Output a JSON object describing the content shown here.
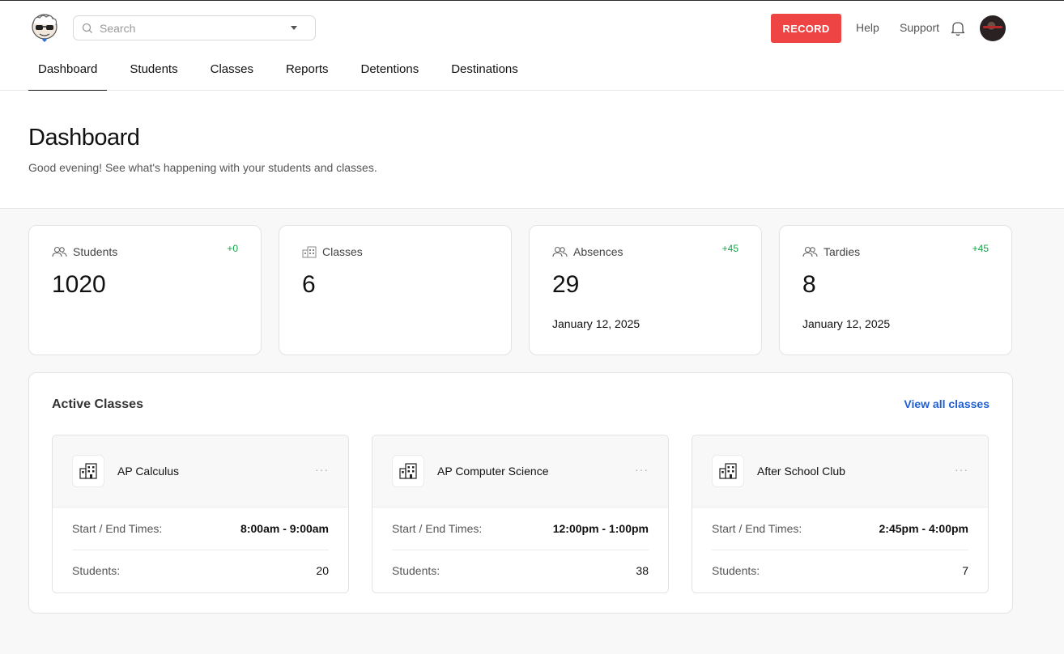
{
  "search": {
    "placeholder": "Search"
  },
  "header": {
    "record_label": "RECORD",
    "help_label": "Help",
    "support_label": "Support"
  },
  "nav": {
    "items": [
      {
        "label": "Dashboard",
        "active": true
      },
      {
        "label": "Students"
      },
      {
        "label": "Classes"
      },
      {
        "label": "Reports"
      },
      {
        "label": "Detentions"
      },
      {
        "label": "Destinations"
      }
    ]
  },
  "page": {
    "title": "Dashboard",
    "subtitle": "Good evening! See what's happening with your students and classes."
  },
  "stats": [
    {
      "label": "Students",
      "value": "1020",
      "delta": "+0",
      "date": "",
      "icon": "users-icon"
    },
    {
      "label": "Classes",
      "value": "6",
      "delta": "",
      "date": "",
      "icon": "building-icon"
    },
    {
      "label": "Absences",
      "value": "29",
      "delta": "+45",
      "date": "January 12, 2025",
      "icon": "users-icon"
    },
    {
      "label": "Tardies",
      "value": "8",
      "delta": "+45",
      "date": "January 12, 2025",
      "icon": "users-icon"
    }
  ],
  "active_classes": {
    "title": "Active Classes",
    "view_all_label": "View all classes",
    "times_label": "Start / End Times:",
    "students_label": "Students:",
    "menu_glyph": "···",
    "classes": [
      {
        "name": "AP Calculus",
        "times": "8:00am - 9:00am",
        "students": "20"
      },
      {
        "name": "AP Computer Science",
        "times": "12:00pm - 1:00pm",
        "students": "38"
      },
      {
        "name": "After School Club",
        "times": "2:45pm - 4:00pm",
        "students": "7"
      }
    ]
  },
  "colors": {
    "record": "#ef4444",
    "delta_positive": "#16a34a",
    "link": "#1d5fd1"
  }
}
